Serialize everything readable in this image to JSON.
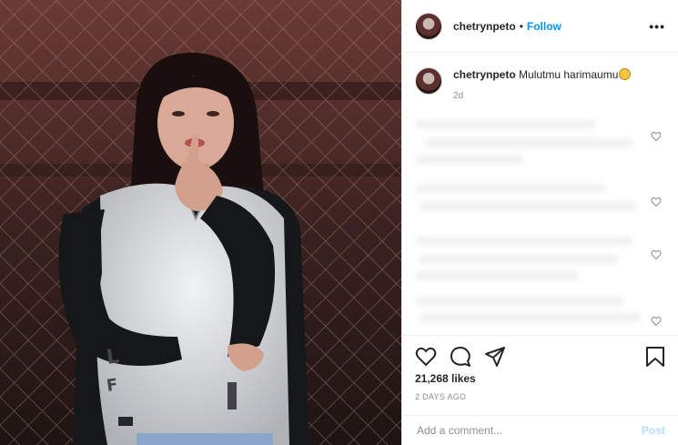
{
  "header": {
    "username": "chetrynpeto",
    "separator": "•",
    "follow_label": "Follow",
    "more_label": "•••"
  },
  "caption": {
    "username": "chetrynpeto",
    "text": "Mulutmu harimaumu",
    "emoji": "smiling-face-icon",
    "time": "2d"
  },
  "actions": {
    "likes": "21,268 likes",
    "posted_ago": "2 DAYS AGO"
  },
  "comment_box": {
    "placeholder": "Add a comment...",
    "post_label": "Post"
  },
  "colors": {
    "follow": "#0095f6",
    "post_disabled": "#b2dffc",
    "text": "#262626",
    "muted": "#8e8e8e"
  },
  "icons": [
    "heart-icon",
    "comment-icon",
    "share-icon",
    "bookmark-icon"
  ]
}
